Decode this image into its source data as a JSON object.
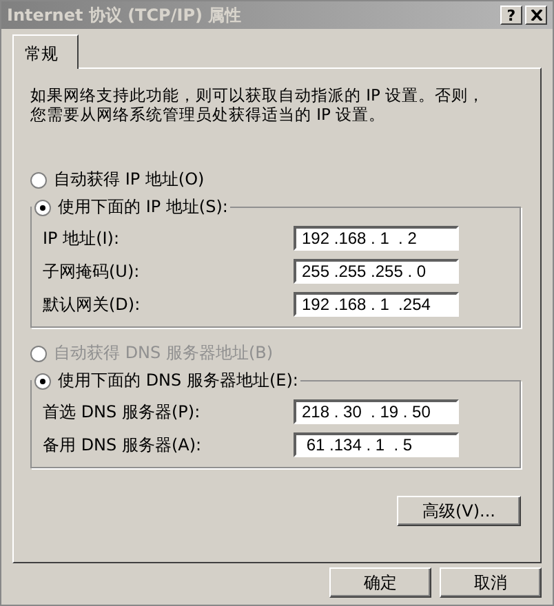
{
  "window": {
    "title": "Internet 协议 (TCP/IP) 属性",
    "help": "?"
  },
  "tabs": [
    {
      "label": "常规",
      "selected": true
    }
  ],
  "description": "如果网络支持此功能，则可以获取自动指派的 IP 设置。否则，您需要从网络系统管理员处获得适当的 IP 设置。",
  "ip_options": [
    {
      "label": "自动获得 IP 地址(O)",
      "selected": false,
      "disabled": false
    },
    {
      "label": "使用下面的 IP 地址(S):",
      "selected": true,
      "disabled": false
    }
  ],
  "ip_fields": [
    {
      "label": "IP 地址(I):",
      "value": "192 .168 . 1  . 2"
    },
    {
      "label": "子网掩码(U):",
      "value": "255 .255 .255 . 0"
    },
    {
      "label": "默认网关(D):",
      "value": "192 .168 . 1  .254"
    }
  ],
  "dns_options": [
    {
      "label": "自动获得 DNS 服务器地址(B)",
      "selected": false,
      "disabled": true
    },
    {
      "label": "使用下面的 DNS 服务器地址(E):",
      "selected": true,
      "disabled": false
    }
  ],
  "dns_fields": [
    {
      "label": "首选 DNS 服务器(P):",
      "value": "218 . 30  . 19 . 50"
    },
    {
      "label": "备用 DNS 服务器(A):",
      "value": " 61 .134 . 1  . 5"
    }
  ],
  "advanced_button": "高级(V)...",
  "buttons": [
    "确定",
    "取消"
  ]
}
